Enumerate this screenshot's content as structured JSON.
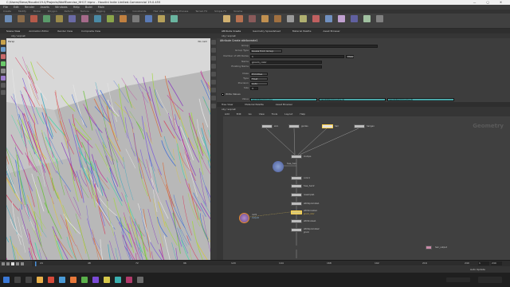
{
  "window": {
    "title": "C:/Users/Steve/Houdini19.0/Projects/WolfExercise_HH17.hipnc - Houdini Indie Limited-Commercial 19.0.455"
  },
  "menubar": {
    "items": [
      "File",
      "Edit",
      "Render",
      "Assets",
      "Windows",
      "Help",
      "Build",
      "Main"
    ]
  },
  "shelf_tabs": [
    "Create",
    "Modify",
    "Model",
    "Polygon",
    "Deform",
    "Texture",
    "Rigging",
    "Characters",
    "Constraints",
    "Hair Utils",
    "Guide Process",
    "Terrain FX",
    "Simple FX",
    "Volume"
  ],
  "viewport": {
    "tabs": [
      "Scene View",
      "Animation Editor",
      "Render View",
      "Composite View"
    ],
    "path": "obj / sopnet",
    "view_label": "Persp",
    "camera_label": "No cam"
  },
  "parameters": {
    "tabs": [
      "Attribute Create",
      "Geometry Spreadsheet",
      "Material Palette",
      "Asset Browser"
    ],
    "node_title": "Attribute Create  attribcreate1",
    "path": "obj / sopnet",
    "rows": [
      {
        "label": "Group",
        "value": ""
      },
      {
        "label": "Group Type",
        "value": "Guess from Group"
      },
      {
        "label": "Number of Attributes",
        "value": "1"
      },
      {
        "label": "Name",
        "value": "groom_color"
      },
      {
        "label": "Existing Name",
        "value": ""
      },
      {
        "label": "Class",
        "value": "Primitive"
      },
      {
        "label": "Type",
        "value": "Float"
      },
      {
        "label": "Precision",
        "value": "Auto"
      },
      {
        "label": "Size",
        "value": "3"
      },
      {
        "label": "Value",
        "value": ""
      }
    ],
    "value_fields": [
      "rand(@primnum)",
      "rand(@primnum+1)",
      "rand(@primnum+2)"
    ],
    "checkbox_label": "Write Values",
    "buttons": [
      "Clear"
    ]
  },
  "network": {
    "tabs": [
      "Tree View",
      "Material Palette",
      "Asset Browser"
    ],
    "path": "obj / sopnet",
    "menu": [
      "Add",
      "Edit",
      "Go",
      "View",
      "Tools",
      "Layout",
      "Help"
    ],
    "watermark": "Geometry",
    "nodes": [
      {
        "name": "skin",
        "label": "skin"
      },
      {
        "name": "guides",
        "label": "guides"
      },
      {
        "name": "hair",
        "label": "hair"
      },
      {
        "name": "hairgen",
        "label": "hairgen"
      },
      {
        "name": "clumps",
        "label": "clumps"
      },
      {
        "name": "fuse",
        "label": "fuse_hair"
      },
      {
        "name": "color1",
        "label": "color1"
      },
      {
        "name": "fuse2",
        "label": "fuse_hair2"
      },
      {
        "name": "resample",
        "label": "resample1"
      },
      {
        "name": "attrib_promote",
        "label": "attribpromote1"
      },
      {
        "name": "attrib_create",
        "label": "attribcreate1",
        "sub": "groom_color"
      },
      {
        "name": "attrib_noise",
        "label": "attribnoise1"
      },
      {
        "name": "null",
        "label": "null1",
        "sub": "Output0"
      },
      {
        "name": "attrib_promote2",
        "label": "attribpromote2",
        "sub": "groom"
      },
      {
        "name": "output",
        "label": "hair_output"
      }
    ]
  },
  "timeline": {
    "start": "1",
    "end": "240",
    "current": "1",
    "ticks": [
      "24",
      "48",
      "72",
      "96",
      "120",
      "144",
      "168",
      "192",
      "216",
      "240"
    ]
  },
  "status": {
    "auto_update": "Auto Update"
  },
  "colors": {
    "accent": "#e88a2e",
    "selected": "#ffd24a",
    "teal_field": "#4aa7a8"
  }
}
